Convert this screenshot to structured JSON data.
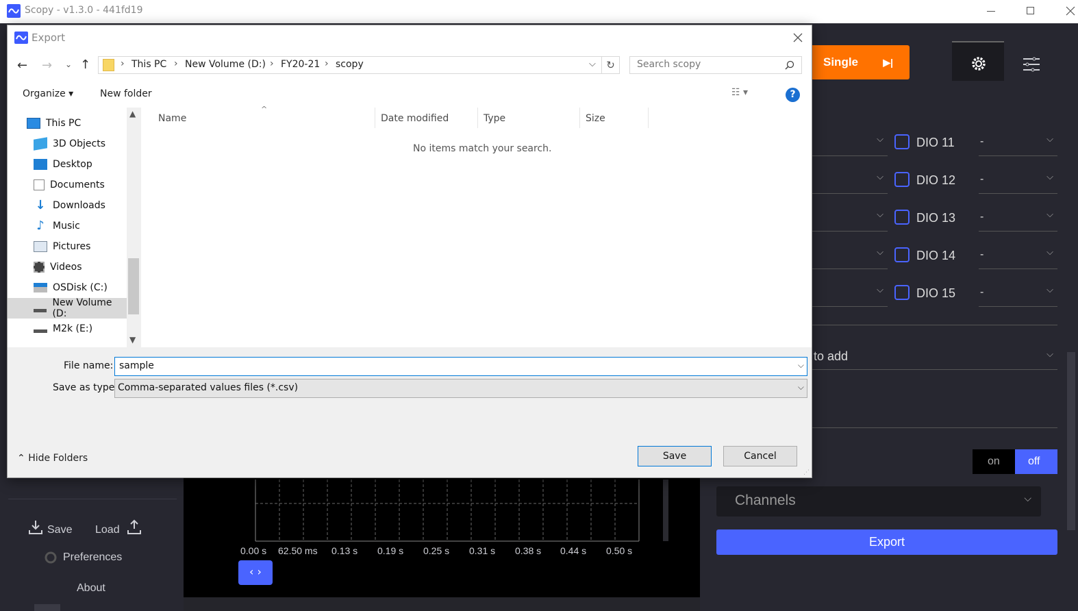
{
  "app": {
    "title": "Scopy - v1.3.0 - 441fd19",
    "window_controls": [
      "minimize-icon",
      "maximize-icon",
      "close-icon"
    ]
  },
  "scopy": {
    "single_button": "Single",
    "dio_rows": [
      {
        "label": "DIO 11",
        "value": "-"
      },
      {
        "label": "DIO 12",
        "value": "-"
      },
      {
        "label": "DIO 13",
        "value": "-"
      },
      {
        "label": "DIO 14",
        "value": "-"
      },
      {
        "label": "DIO 15",
        "value": "-"
      }
    ],
    "add_select": "to add",
    "toggle_on": "on",
    "toggle_off": "off",
    "channels_select": "Channels",
    "export_button": "Export",
    "left_menu": {
      "save": "Save",
      "load": "Load",
      "preferences": "Preferences",
      "about": "About"
    },
    "time_ticks": [
      "0.00 s",
      "62.50 ms",
      "0.13 s",
      "0.19 s",
      "0.25 s",
      "0.31 s",
      "0.38 s",
      "0.44 s",
      "0.50 s"
    ],
    "accent": "#4a64ff",
    "orange": "#ff7200"
  },
  "dialog": {
    "title": "Export",
    "breadcrumb": [
      "This PC",
      "New Volume (D:)",
      "FY20-21",
      "scopy"
    ],
    "search_placeholder": "Search scopy",
    "toolbar": {
      "organize": "Organize",
      "new_folder": "New folder"
    },
    "tree": [
      {
        "label": "This PC",
        "icon": "computer-icon"
      },
      {
        "label": "3D Objects",
        "icon": "cube-icon"
      },
      {
        "label": "Desktop",
        "icon": "desktop-icon"
      },
      {
        "label": "Documents",
        "icon": "document-icon"
      },
      {
        "label": "Downloads",
        "icon": "download-arrow-icon"
      },
      {
        "label": "Music",
        "icon": "music-note-icon"
      },
      {
        "label": "Pictures",
        "icon": "picture-icon"
      },
      {
        "label": "Videos",
        "icon": "film-icon"
      },
      {
        "label": "OSDisk (C:)",
        "icon": "windows-drive-icon"
      },
      {
        "label": "New Volume (D:",
        "icon": "drive-icon",
        "selected": true
      },
      {
        "label": "M2k (E:)",
        "icon": "drive-icon"
      }
    ],
    "columns": [
      "Name",
      "Date modified",
      "Type",
      "Size"
    ],
    "empty_message": "No items match your search.",
    "file_name_label": "File name:",
    "file_name_value": "sample",
    "save_type_label": "Save as type:",
    "save_type_value": "Comma-separated values files (*.csv)",
    "hide_folders": "Hide Folders",
    "save_button": "Save",
    "cancel_button": "Cancel"
  }
}
